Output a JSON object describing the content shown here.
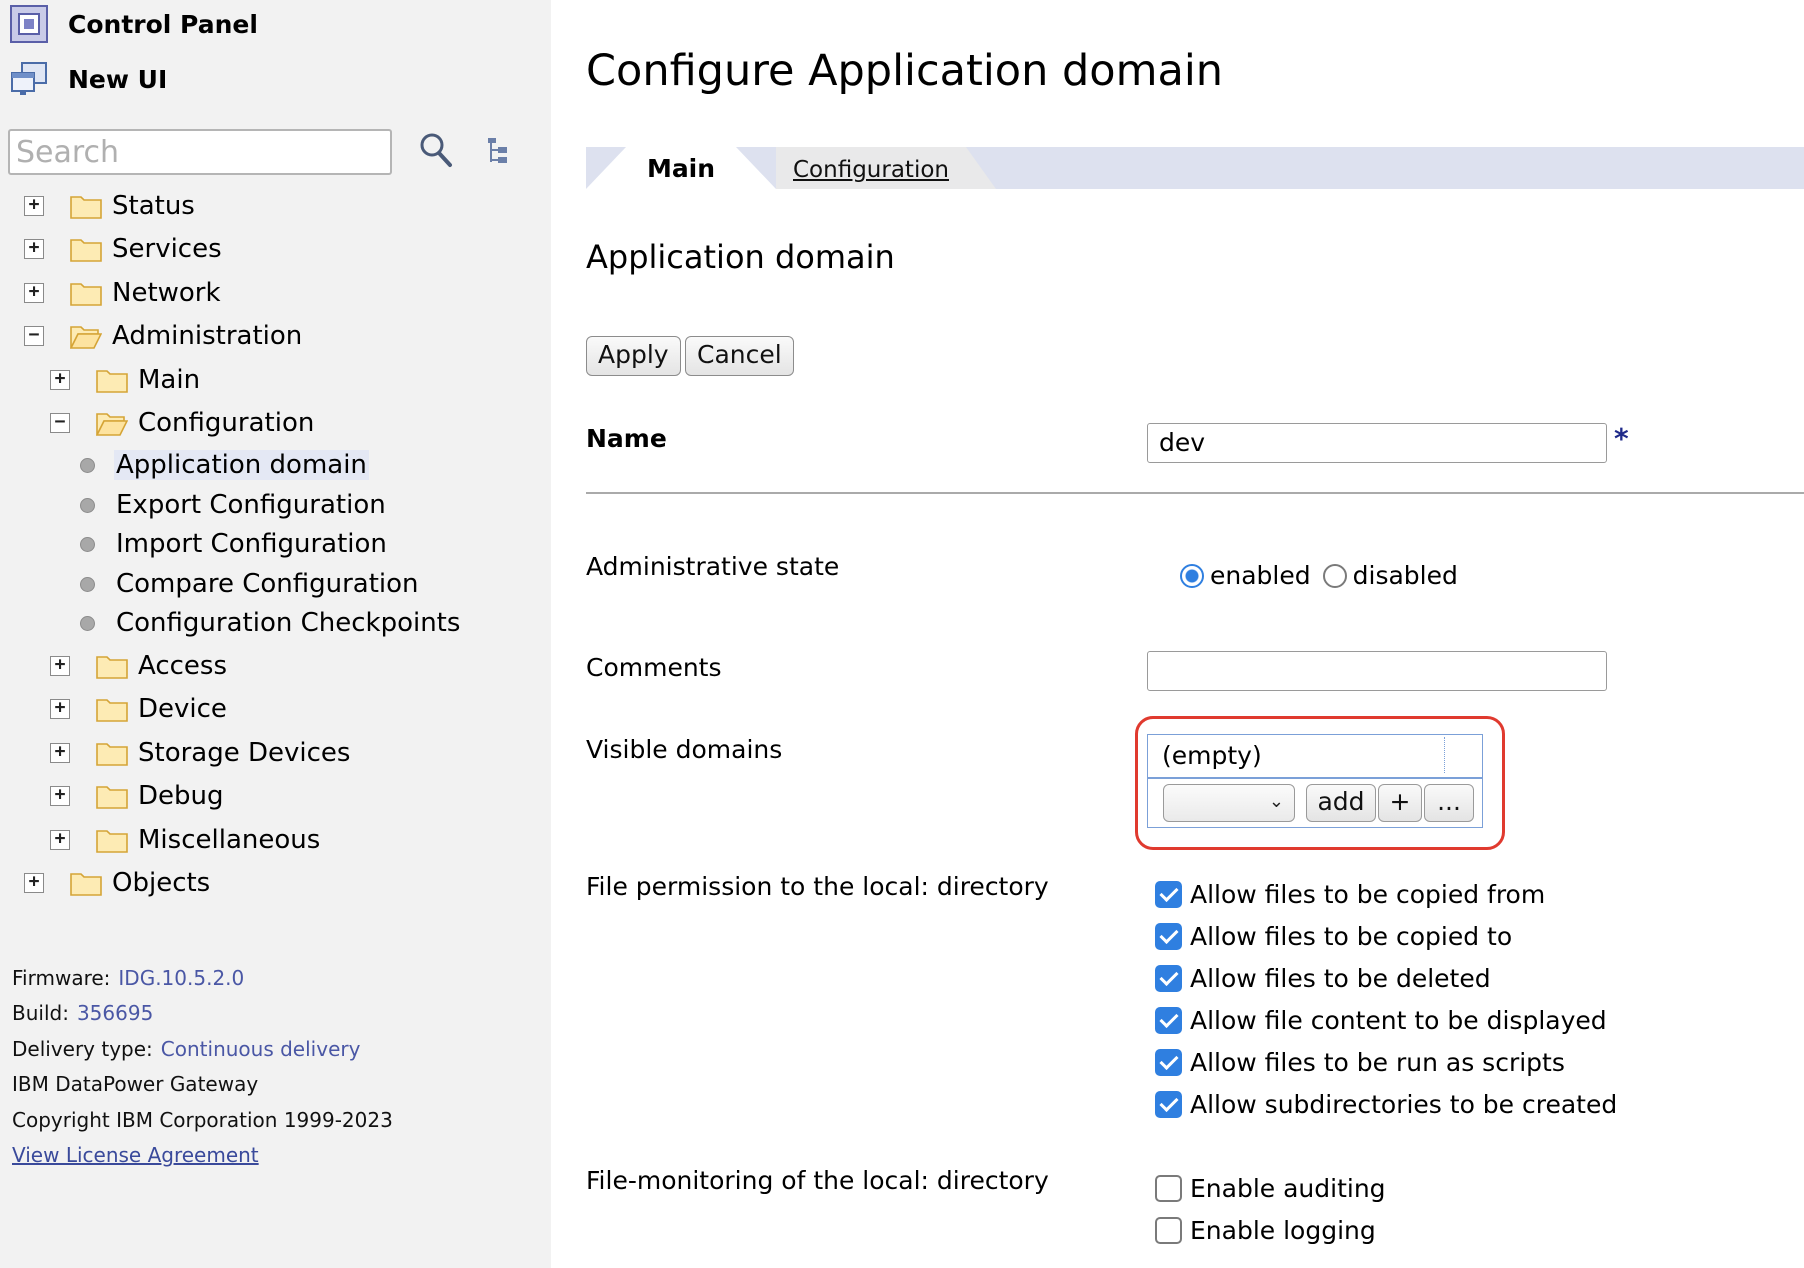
{
  "sidebar": {
    "control_panel": "Control Panel",
    "new_ui": "New UI",
    "search_placeholder": "Search",
    "tree": {
      "status": "Status",
      "services": "Services",
      "network": "Network",
      "administration": "Administration",
      "main": "Main",
      "configuration": "Configuration",
      "application_domain": "Application domain",
      "export_configuration": "Export Configuration",
      "import_configuration": "Import Configuration",
      "compare_configuration": "Compare Configuration",
      "configuration_checkpoints": "Configuration Checkpoints",
      "access": "Access",
      "device": "Device",
      "storage_devices": "Storage Devices",
      "debug": "Debug",
      "miscellaneous": "Miscellaneous",
      "objects": "Objects"
    },
    "footer": {
      "firmware_label": "Firmware:",
      "firmware_value": "IDG.10.5.2.0",
      "build_label": "Build:",
      "build_value": "356695",
      "delivery_label": "Delivery type:",
      "delivery_value": "Continuous delivery",
      "product": "IBM DataPower Gateway",
      "copyright": "Copyright IBM Corporation 1999-2023",
      "license_link": "View License Agreement"
    }
  },
  "main": {
    "title": "Configure Application domain",
    "tabs": {
      "main": "Main",
      "configuration": "Configuration"
    },
    "section_title": "Application domain",
    "buttons": {
      "apply": "Apply",
      "cancel": "Cancel"
    },
    "name": {
      "label": "Name",
      "value": "dev",
      "required_mark": "*"
    },
    "admin_state": {
      "label": "Administrative state",
      "enabled": "enabled",
      "disabled": "disabled",
      "selected": "enabled"
    },
    "comments": {
      "label": "Comments",
      "value": ""
    },
    "visible_domains": {
      "label": "Visible domains",
      "empty_text": "(empty)",
      "add": "add",
      "plus": "+",
      "more": "..."
    },
    "file_permission": {
      "label": "File permission to the local: directory",
      "options": [
        {
          "label": "Allow files to be copied from",
          "checked": true
        },
        {
          "label": "Allow files to be copied to",
          "checked": true
        },
        {
          "label": "Allow files to be deleted",
          "checked": true
        },
        {
          "label": "Allow file content to be displayed",
          "checked": true
        },
        {
          "label": "Allow files to be run as scripts",
          "checked": true
        },
        {
          "label": "Allow subdirectories to be created",
          "checked": true
        }
      ]
    },
    "file_monitoring": {
      "label": "File-monitoring of the local: directory",
      "options": [
        {
          "label": "Enable auditing",
          "checked": false
        },
        {
          "label": "Enable logging",
          "checked": false
        }
      ]
    }
  },
  "colors": {
    "accent": "#2f7fe0",
    "highlight": "#e03a2f",
    "tab_bar": "#dde1ef",
    "link": "#4a57a5"
  }
}
